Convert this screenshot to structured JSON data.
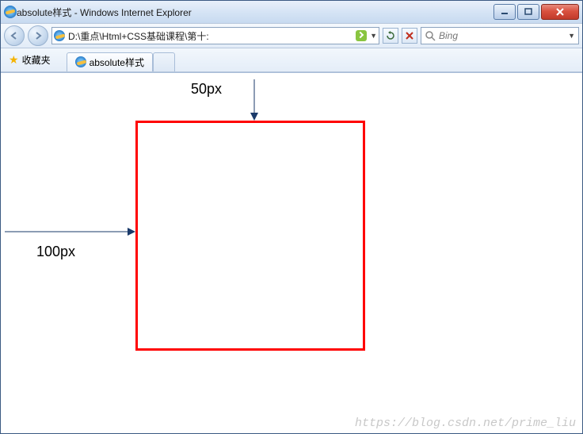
{
  "window": {
    "title": "absolute样式 - Windows Internet Explorer"
  },
  "address": {
    "path": "D:\\重点\\Html+CSS基础课程\\第十:"
  },
  "search": {
    "placeholder": "Bing"
  },
  "favorites": {
    "label": "收藏夹"
  },
  "tab": {
    "title": "absolute样式"
  },
  "diagram": {
    "top_label": "50px",
    "left_label": "100px"
  },
  "watermark": "https://blog.csdn.net/prime_liu"
}
